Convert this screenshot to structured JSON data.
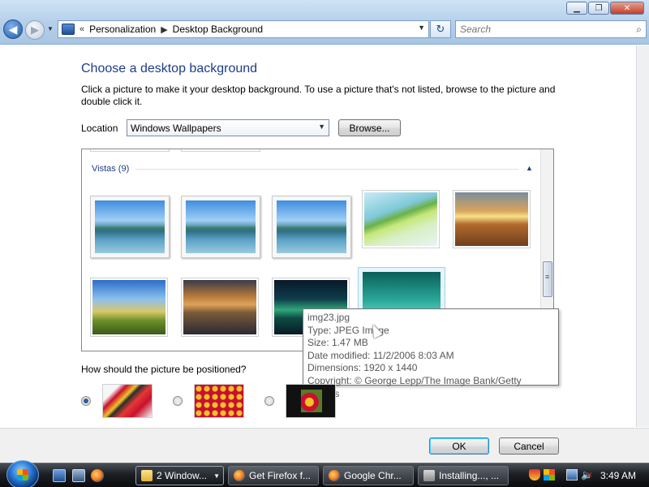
{
  "window": {
    "minimize_glyph": "▁",
    "restore_glyph": "❐",
    "close_glyph": "✕"
  },
  "nav": {
    "back_glyph": "◀",
    "forward_glyph": "▶",
    "history_glyph": "▼"
  },
  "address": {
    "overflow_glyph": "«",
    "crumbs": [
      "Personalization",
      "Desktop Background"
    ],
    "separator": "▶",
    "dropdown_glyph": "▼",
    "refresh_glyph": "↻"
  },
  "search": {
    "placeholder": "Search",
    "icon": "⌕"
  },
  "content": {
    "heading": "Choose a desktop background",
    "intro": "Click a picture to make it your desktop background. To use a picture that's not listed, browse to the picture and double click it.",
    "location_label": "Location",
    "location_value": "Windows Wallpapers",
    "location_arrow": "▼",
    "browse_label": "Browse..."
  },
  "gallery": {
    "group_title": "Vistas (9)",
    "collapse_glyph": "▲",
    "images": [
      {
        "name": "vista-1",
        "style": "vista"
      },
      {
        "name": "vista-2",
        "style": "vista"
      },
      {
        "name": "vista-3",
        "style": "vista"
      },
      {
        "name": "palm-frond",
        "style": "palm"
      },
      {
        "name": "wheat-field-sunset",
        "style": "wheat"
      },
      {
        "name": "hills-under-sky",
        "style": "hills"
      },
      {
        "name": "rock-reflection",
        "style": "rocks"
      },
      {
        "name": "aurora",
        "style": "aurora"
      },
      {
        "name": "img23",
        "style": "aqua",
        "selected": true
      }
    ]
  },
  "tooltip": {
    "filename": "img23.jpg",
    "type": "Type: JPEG Image",
    "size": "Size: 1.47 MB",
    "date_modified": "Date modified: 11/2/2006 8:03 AM",
    "dimensions": "Dimensions: 1920 x 1440",
    "copyright": "Copyright: © George Lepp/The Image Bank/Getty Images"
  },
  "position": {
    "label": "How should the picture be positioned?",
    "options": [
      {
        "name": "fit-to-screen",
        "selected": true
      },
      {
        "name": "tile",
        "selected": false
      },
      {
        "name": "center",
        "selected": false
      }
    ]
  },
  "buttons": {
    "ok": "OK",
    "cancel": "Cancel"
  },
  "taskbar": {
    "tasks": [
      {
        "label": "2 Window...",
        "icon": "folder-icon",
        "active": true,
        "dropdown": "▼"
      },
      {
        "label": "Get Firefox f...",
        "icon": "firefox-icon",
        "active": false
      },
      {
        "label": "Google Chr...",
        "icon": "chrome-icon",
        "active": false
      },
      {
        "label": "Installing..., ...",
        "icon": "setup-icon",
        "active": false
      }
    ],
    "volume_glyph": "🔈",
    "clock": "3:49 AM"
  }
}
